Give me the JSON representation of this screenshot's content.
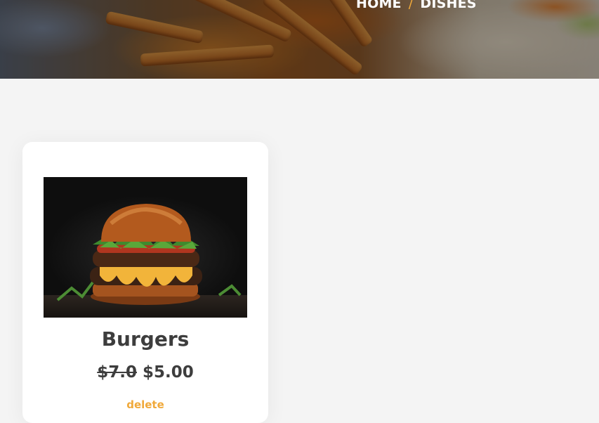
{
  "breadcrumb": {
    "home": "HOME",
    "separator": "/",
    "current": "DISHES"
  },
  "dish": {
    "name": "Burgers",
    "old_price": "$7.0",
    "price": "$5.00",
    "delete_label": "delete"
  },
  "colors": {
    "accent": "#f0a93a",
    "text": "#3d3d3d",
    "background": "#f4f4f4"
  }
}
